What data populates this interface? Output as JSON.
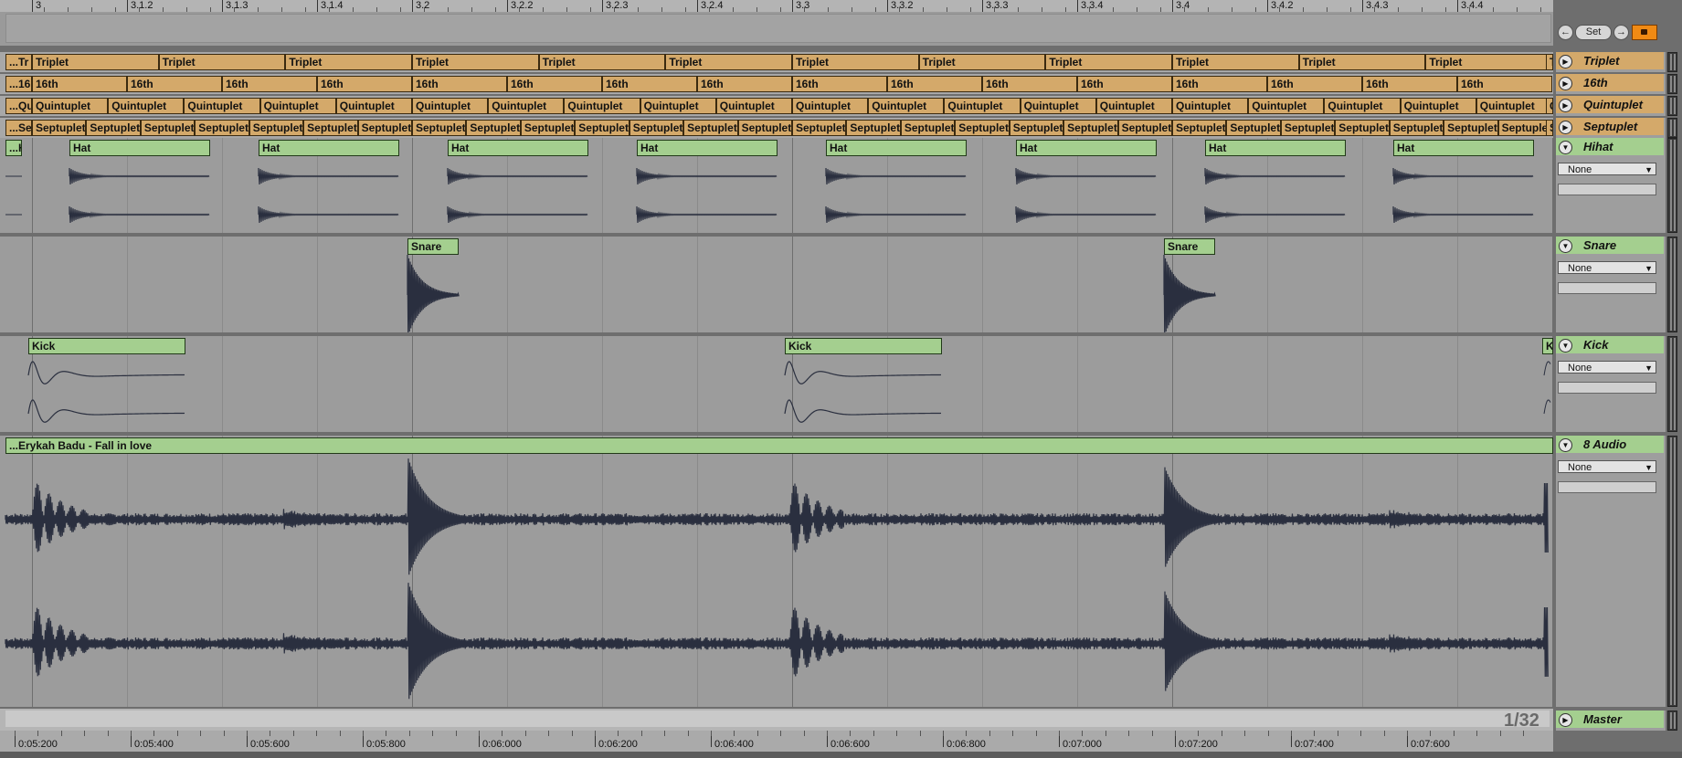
{
  "ruler": {
    "beats": [
      "3",
      "3.1.2",
      "3.1.3",
      "3.1.4",
      "3.2",
      "3.2.2",
      "3.2.3",
      "3.2.4",
      "3.3",
      "3.3.2",
      "3.3.3",
      "3.3.4",
      "3.4",
      "3.4.2",
      "3.4.3",
      "3.4.4"
    ]
  },
  "header": {
    "back_label": "←",
    "set_label": "Set",
    "forward_label": "→"
  },
  "groove_tracks": [
    {
      "name": "Triplet",
      "lead_label": "...Tr",
      "clip_label": "Triplet",
      "divisions": 12,
      "trail_label": "T"
    },
    {
      "name": "16th",
      "lead_label": "...16",
      "clip_label": "16th",
      "divisions": 16,
      "trail_label": ""
    },
    {
      "name": "Quintuplet",
      "lead_label": "...Qu",
      "clip_label": "Quintuplet",
      "divisions": 20,
      "trail_label": "Q"
    },
    {
      "name": "Septuplet",
      "lead_label": "...Se",
      "clip_label": "Septuplet",
      "divisions": 28,
      "trail_label": "S"
    }
  ],
  "audio_tracks": [
    {
      "name": "Hihat",
      "input_label": "None",
      "lead_label": "...H",
      "clips": [
        {
          "label": "Hat"
        },
        {
          "label": "Hat"
        },
        {
          "label": "Hat"
        },
        {
          "label": "Hat"
        },
        {
          "label": "Hat"
        },
        {
          "label": "Hat"
        },
        {
          "label": "Hat"
        },
        {
          "label": "Hat"
        }
      ]
    },
    {
      "name": "Snare",
      "input_label": "None",
      "clips": [
        {
          "label": "Snare"
        },
        {
          "label": "Snare"
        }
      ]
    },
    {
      "name": "Kick",
      "input_label": "None",
      "clips": [
        {
          "label": "Kick"
        },
        {
          "label": "Kick"
        }
      ],
      "trail_label": "K"
    },
    {
      "name": "8 Audio",
      "input_label": "None",
      "clips": [
        {
          "label": "...Erykah Badu - Fall in love"
        }
      ]
    }
  ],
  "master": {
    "name": "Master",
    "quantization": "1/32"
  },
  "time_ruler": [
    "0:05:200",
    "0:05:400",
    "0:05:600",
    "0:05:800",
    "0:06:000",
    "0:06:200",
    "0:06:400",
    "0:06:600",
    "0:06:800",
    "0:07:000",
    "0:07:200",
    "0:07:400",
    "0:07:600"
  ],
  "colors": {
    "groove_clip": "#d4a96a",
    "audio_clip": "#a4cf8f",
    "waveform": "#2a2f3f",
    "lock_button": "#f08a14"
  }
}
